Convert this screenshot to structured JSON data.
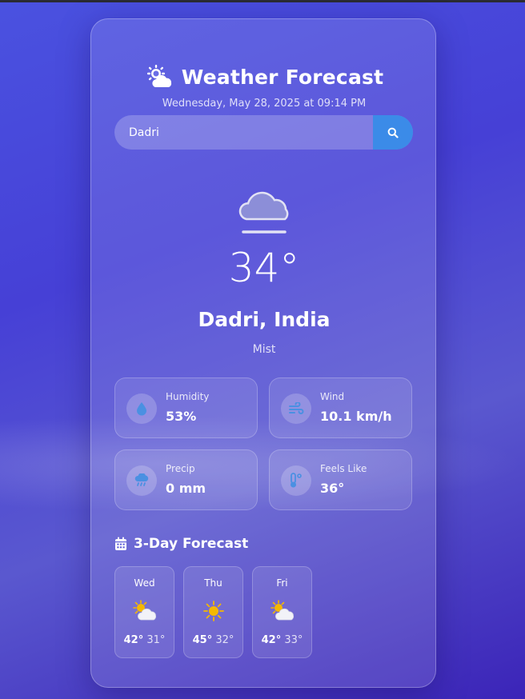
{
  "header": {
    "title": "Weather Forecast",
    "title_icon": "sun-cloud-icon",
    "datetime": "Wednesday, May 28, 2025 at 09:14 PM"
  },
  "search": {
    "value": "Dadri",
    "button_icon": "search-icon"
  },
  "current": {
    "icon": "mist-cloud-icon",
    "temperature": "34°",
    "location": "Dadri, India",
    "condition": "Mist"
  },
  "stats": [
    {
      "label": "Humidity",
      "value": "53%",
      "icon": "droplet-icon"
    },
    {
      "label": "Wind",
      "value": "10.1 km/h",
      "icon": "wind-icon"
    },
    {
      "label": "Precip",
      "value": "0 mm",
      "icon": "cloud-rain-icon"
    },
    {
      "label": "Feels Like",
      "value": "36°",
      "icon": "temperature-icon"
    }
  ],
  "forecast": {
    "title": "3-Day Forecast",
    "icon": "calendar-icon",
    "days": [
      {
        "day": "Wed",
        "max": "42°",
        "min": "31°",
        "icon": "partly-cloudy-icon"
      },
      {
        "day": "Thu",
        "max": "45°",
        "min": "32°",
        "icon": "sunny-icon"
      },
      {
        "day": "Fri",
        "max": "42°",
        "min": "33°",
        "icon": "partly-cloudy-icon"
      }
    ]
  },
  "colors": {
    "accent": "#3b8be8",
    "icon_blue": "#4a90e2",
    "sun": "#f5b800"
  }
}
